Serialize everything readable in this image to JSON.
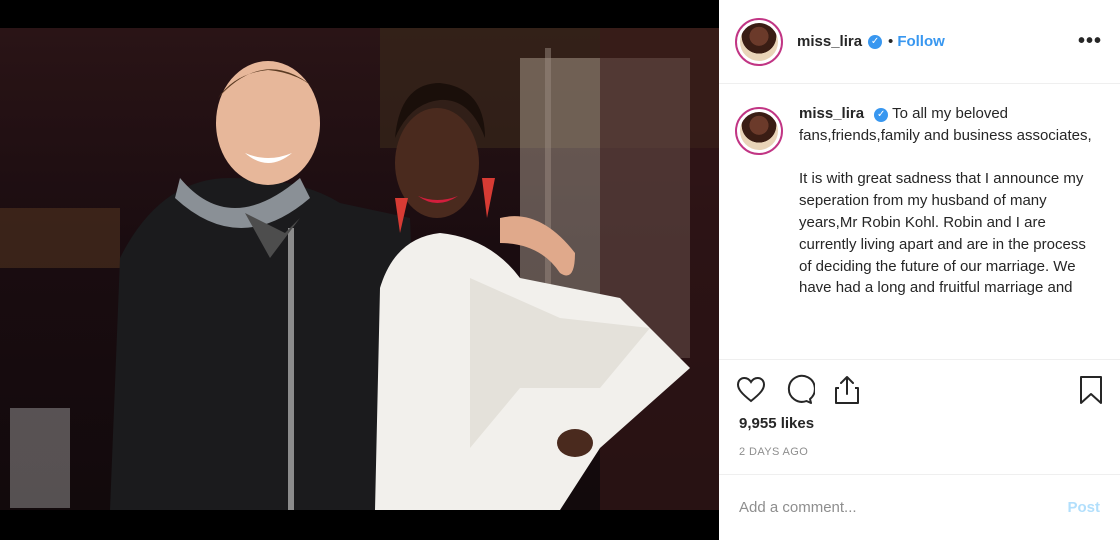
{
  "header": {
    "username": "miss_lira",
    "separator": "•",
    "follow_label": "Follow",
    "more_label": "•••",
    "icons": [
      "verified-badge-icon",
      "more-options-icon"
    ]
  },
  "caption": {
    "username": "miss_lira",
    "text": "To all my beloved fans,friends,family and business associates,\n\nIt is with great sadness that I announce my seperation from my husband of many years,Mr Robin Kohl. Robin and I are currently living apart and are in the process of deciding the future of our marriage. We have had a long and fruitful marriage and"
  },
  "actions": {
    "icons": [
      "heart-icon",
      "comment-icon",
      "share-icon",
      "bookmark-icon"
    ]
  },
  "likes": "9,955 likes",
  "time_ago": "2 DAYS AGO",
  "comment": {
    "placeholder": "Add a comment...",
    "post_label": "Post"
  },
  "colors": {
    "link": "#3897f0",
    "post_disabled": "#b2dffc",
    "muted": "#8e8e8e",
    "avatar_ring": "#c13584"
  }
}
